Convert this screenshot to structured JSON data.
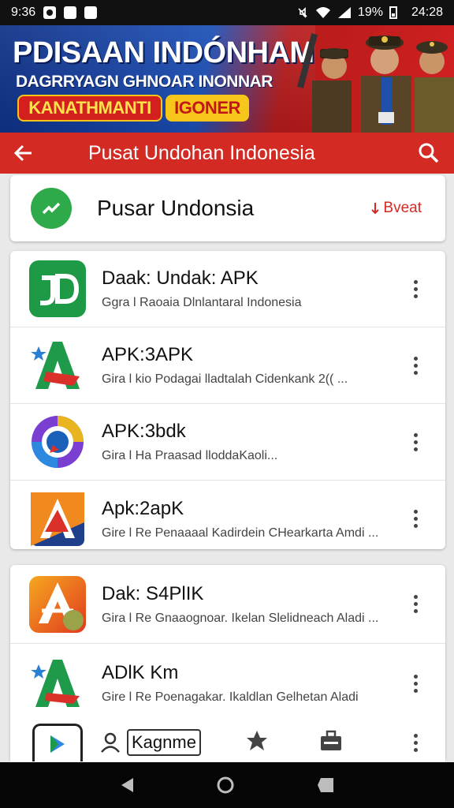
{
  "status_bar": {
    "left_time": "9:36",
    "battery": "19%",
    "clock": "24:28"
  },
  "banner": {
    "title": "PDISAAN INDÓNHAM",
    "subtitle": "DAGRRYAGN GHNOAR INONNAR",
    "red_button": "KANATHMANTI",
    "yellow_button": "IGONER"
  },
  "app_bar": {
    "title": "Pusat Undohan Indonesia"
  },
  "header_card": {
    "title": "Pusar Undonsia",
    "action_label": "Bveat",
    "action_color": "#d32a24"
  },
  "apps": [
    {
      "title": "Daak: Undak: APK",
      "subtitle": "Ggra l Raoaia Dlnlantaral Indonesia",
      "icon": "jd-icon"
    },
    {
      "title": "APK:3APK",
      "subtitle": "Gira l kio Podagai lladtalah Cidenkank 2(( ...",
      "icon": "a-logo-icon"
    },
    {
      "title": "APK:3bdk",
      "subtitle": "Gira l Ha Praasad lloddaKaoli...",
      "icon": "chat-circle-icon"
    },
    {
      "title": "Apk:2apK",
      "subtitle": "Gire l Re Penaaaal Kadirdein CHearkarta Amdi ...",
      "icon": "a-logo-icon"
    },
    {
      "title": "Dak: S4PlIK",
      "subtitle": "Gira l Re Gnaaognoar. Ikelan Slelidneach Aladi ...",
      "icon": "a-logo-icon"
    },
    {
      "title": "ADlK Km",
      "subtitle": "Gire l Re Poenagakar. Ikaldlan Gelhetan Aladi",
      "icon": "a-logo-icon"
    }
  ],
  "bottom_tabs": {
    "profile_label": "Kagnme"
  },
  "colors": {
    "accent_red": "#d32a24",
    "green": "#2eaa4a",
    "banner_blue": "#1b4fb7"
  }
}
